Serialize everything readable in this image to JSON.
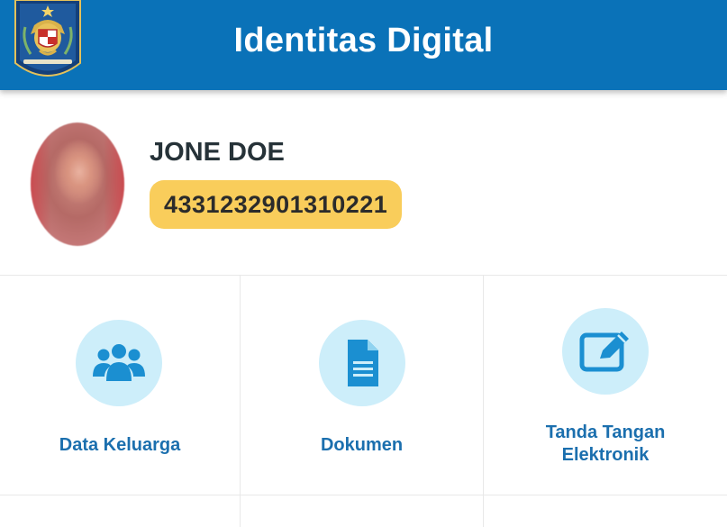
{
  "header": {
    "title": "Identitas Digital",
    "background_color": "#0a72b8"
  },
  "logo": {
    "icon": "garuda-emblem-icon"
  },
  "profile": {
    "name": "JONE DOE",
    "nik": "4331232901310221",
    "nik_badge_color": "#f9cd5b"
  },
  "menu": {
    "items": [
      {
        "label": "Data Keluarga",
        "icon": "family-icon"
      },
      {
        "label": "Dokumen",
        "icon": "document-icon"
      },
      {
        "label": "Tanda Tangan Elektronik",
        "icon": "signature-edit-icon"
      }
    ],
    "label_color": "#1b6fae",
    "icon_color": "#1b8fd1",
    "icon_bg_color": "#cdeefa"
  }
}
